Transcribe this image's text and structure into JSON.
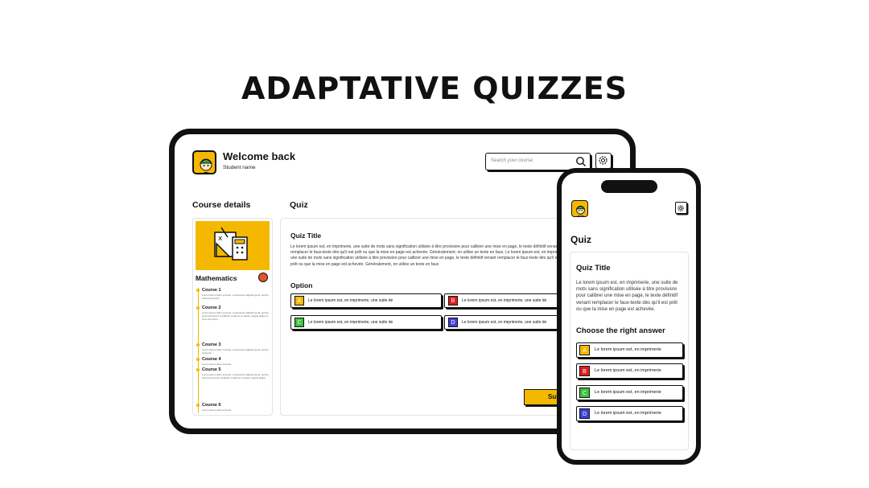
{
  "headline": "ADAPTATIVE QUIZZES",
  "tablet": {
    "welcome": "Welcome back",
    "student": "Student name",
    "search_placeholder": "Search your course",
    "course_details_heading": "Course details",
    "quiz_heading": "Quiz",
    "subject": "Mathematics",
    "courses": [
      {
        "title": "Course 1",
        "desc": "Lorem ipsum dolor sit amet, consectetur adipiscing elit, sed do eiusmod tempor."
      },
      {
        "title": "Course 2",
        "desc": "Lorem ipsum dolor sit amet, consectetur adipiscing elit, sed do eiusmod tempor incididunt ut labore et dolore magna aliqua ut enim ad minim."
      },
      {
        "title": "Course 3",
        "desc": "Lorem ipsum dolor sit amet, consectetur adipiscing elit, sed do eiusmod."
      },
      {
        "title": "Course 4",
        "desc": "Lorem ipsum dolor sit amet."
      },
      {
        "title": "Course 5",
        "desc": "Lorem ipsum dolor sit amet, consectetur adipiscing elit, sed do eiusmod tempor incididunt ut labore et dolore magna aliqua."
      },
      {
        "title": "Course 6",
        "desc": "Lorem ipsum dolor sit amet."
      }
    ],
    "quiz_title": "Quiz Title",
    "quiz_text": "Le lorem ipsum est, en imprimerie, une suite de mots sans signification utilisée à titre provisoire pour calibrer une mise en page, le texte définitif venant remplacer le faux-texte dès qu'il est prêt ou que la mise en page est achevée. Généralement, on utilise un texte en faux. Le lorem ipsum est, en imprimerie, une suite de mots sans signification utilisée à titre provisoire pour calibrer une mise en page, le texte définitif venant remplacer le faux-texte dès qu'il est prêt ou que la mise en page est achevée. Généralement, on utilise un texte en faux",
    "option_heading": "Option",
    "options": [
      {
        "letter": "A",
        "text": "Le lorem ipsum est, en imprimerie, une suite de"
      },
      {
        "letter": "B",
        "text": "Le lorem ipsum est, en imprimerie, une suite de"
      },
      {
        "letter": "C",
        "text": "Le lorem ipsum est, en imprimerie, une suite de"
      },
      {
        "letter": "D",
        "text": "Le lorem ipsum est, en imprimerie, une suite de"
      }
    ],
    "submit": "Submit"
  },
  "phone": {
    "quiz_heading": "Quiz",
    "quiz_title": "Quiz Title",
    "quiz_text": "Le lorem ipsum est, en imprimerie, une suite de mots sans signification utilisée à titre provisoire pour calibrer une mise en page, le texte définitif venant remplacer le faux-texte dès qu'il est prêt ou que la mise en page est achevée.",
    "choose_heading": "Choose the right answer",
    "options": [
      {
        "letter": "A",
        "text": "Le lorem ipsum est, en imprimerie"
      },
      {
        "letter": "B",
        "text": "Le lorem ipsum est, en imprimerie"
      },
      {
        "letter": "C",
        "text": "Le lorem ipsum est, en imprimerie"
      },
      {
        "letter": "D",
        "text": "Le lorem ipsum est, en imprimerie"
      }
    ]
  },
  "colors": {
    "accent": "#f5b800",
    "option_a": "#f5b800",
    "option_b": "#e01e1e",
    "option_c": "#3cc23c",
    "option_d": "#4040d8",
    "badge": "#e8542a"
  },
  "icons": [
    "avatar-icon",
    "search-icon",
    "gear-icon",
    "math-tools-icon",
    "notification-badge-icon"
  ]
}
